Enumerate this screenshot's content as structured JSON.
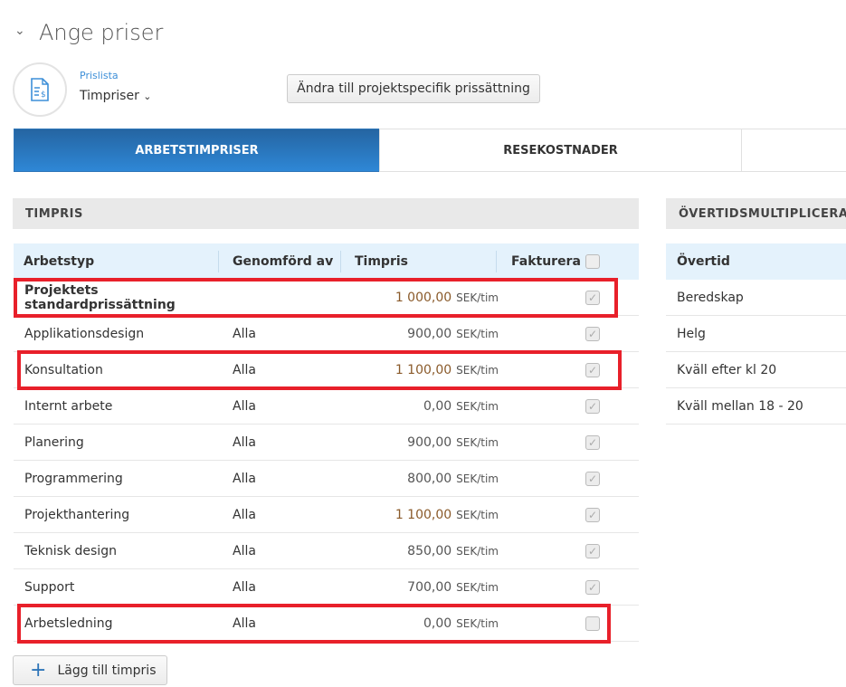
{
  "header": {
    "title": "Ange priser",
    "pricelist_label": "Prislista",
    "pricelist_value": "Timpriser",
    "change_button": "Ändra till projektspecifik prissättning"
  },
  "tabs": [
    {
      "label": "ARBETSTIMPRISER",
      "active": true
    },
    {
      "label": "RESEKOSTNADER",
      "active": false
    },
    {
      "label": "",
      "active": false
    }
  ],
  "timpris": {
    "section_title": "TIMPRIS",
    "columns": [
      "Arbetstyp",
      "Genomförd av",
      "Timpris",
      "Fakturera"
    ],
    "unit": "SEK/tim",
    "rows": [
      {
        "type": "Projektets standardprissättning",
        "by": "",
        "price": "1 000,00",
        "invoice": true,
        "bold": true,
        "highlighted": true
      },
      {
        "type": "Applikationsdesign",
        "by": "Alla",
        "price": "900,00",
        "invoice": true
      },
      {
        "type": "Konsultation",
        "by": "Alla",
        "price": "1 100,00",
        "invoice": true,
        "highlighted": true
      },
      {
        "type": "Internt arbete",
        "by": "Alla",
        "price": "0,00",
        "invoice": true
      },
      {
        "type": "Planering",
        "by": "Alla",
        "price": "900,00",
        "invoice": true
      },
      {
        "type": "Programmering",
        "by": "Alla",
        "price": "800,00",
        "invoice": true
      },
      {
        "type": "Projekthantering",
        "by": "Alla",
        "price": "1 100,00",
        "invoice": true
      },
      {
        "type": "Teknisk design",
        "by": "Alla",
        "price": "850,00",
        "invoice": true
      },
      {
        "type": "Support",
        "by": "Alla",
        "price": "700,00",
        "invoice": true
      },
      {
        "type": "Arbetsledning",
        "by": "Alla",
        "price": "0,00",
        "invoice": false,
        "highlighted": true
      }
    ],
    "add_button": "Lägg till timpris"
  },
  "overtime": {
    "section_title": "ÖVERTIDSMULTIPLICERARE",
    "column": "Övertid",
    "rows": [
      "Beredskap",
      "Helg",
      "Kväll efter kl 20",
      "Kväll mellan 18 - 20"
    ]
  },
  "colors": {
    "accent": "#2e87d6",
    "highlight": "#e8202a"
  }
}
